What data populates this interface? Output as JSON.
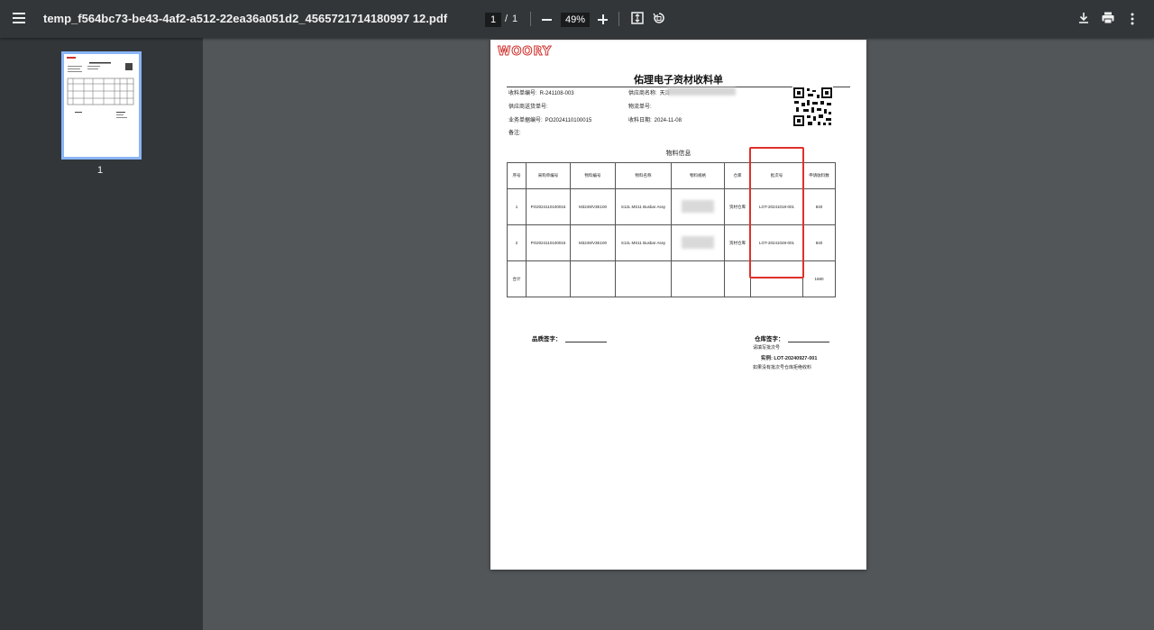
{
  "toolbar": {
    "filename": "temp_f564bc73-be43-4af2-a512-22ea36a051d2_4565721714180997 12.pdf",
    "current_page": "1",
    "page_separator": "/",
    "total_pages": "1",
    "zoom": "49%"
  },
  "sidebar": {
    "thumbnail_page_number": "1"
  },
  "document": {
    "logo": "WOORY",
    "title": "佑理电子资材收料单",
    "fields": {
      "receipt_no_label": "收料单编号:",
      "receipt_no": "R-241108-003",
      "supplier_label": "供应商名称:",
      "supplier_value": "天津",
      "delivery_no_label": "供应商送货单号:",
      "logistics_no_label": "物流单号:",
      "business_no_label": "业务单据编号:",
      "business_no": "PO2024110100015",
      "receipt_date_label": "收料日期:",
      "receipt_date": "2024-11-08",
      "remark_label": "备注:"
    },
    "section_title": "物料信息",
    "table": {
      "headers": [
        "序号",
        "采购单编号",
        "物料编号",
        "物料名称",
        "物料规格",
        "仓库",
        "批次号",
        "申请收料数"
      ],
      "rows": [
        [
          "1",
          "PO2024110100015",
          "M3249/V3E100",
          "S12L MS11 Busbar Assy",
          "",
          "资材仓库",
          "LOT-20241018-001",
          "840"
        ],
        [
          "2",
          "PO2024110100015",
          "M3249/V3E100",
          "S12L MS11 Busbar Assy",
          "",
          "资材仓库",
          "LOT-20241028-001",
          "840"
        ]
      ],
      "total_label": "合计",
      "total_qty": "1680"
    },
    "signature": {
      "quality_label": "品质签字：",
      "warehouse_label": "仓库签字：",
      "note1": "请填写批次号",
      "example_label": "实例:",
      "example_value": "LOT-20240927-001",
      "note2": "如果没有批次号仓库拒绝收料"
    }
  }
}
